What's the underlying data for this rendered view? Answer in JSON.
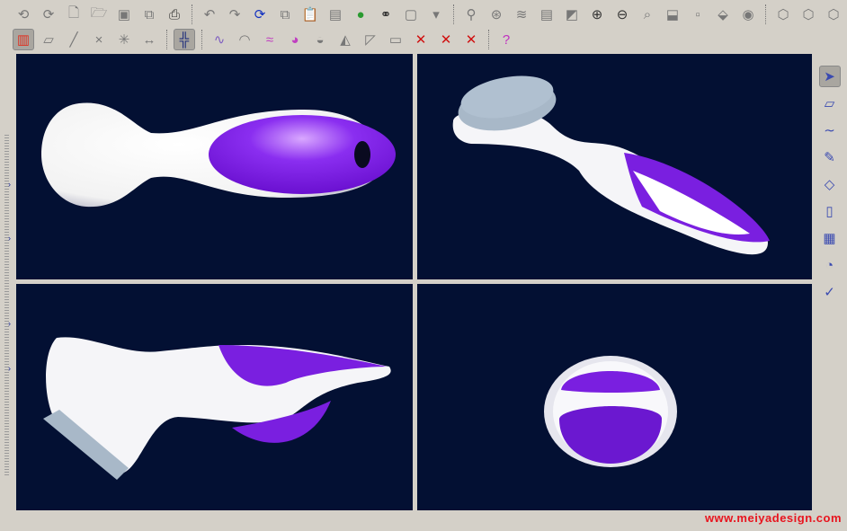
{
  "toolbar_row1": [
    "regenerate-icon",
    "regenerate-manager-icon",
    "new-file-icon",
    "open-folder-icon",
    "save-icon",
    "save-copy-icon",
    "print-icon",
    "|",
    "undo-icon",
    "redo-icon",
    "refresh-icon",
    "copy-icon",
    "paste-icon",
    "paste-special-icon",
    "traffic-light-icon",
    "find-binoculars-icon",
    "select-box-icon",
    "dropdown-icon",
    "|",
    "datum-display-icon",
    "spin-center-icon",
    "layers-icon",
    "model-tree-icon",
    "repaint-icon",
    "zoom-in-icon",
    "zoom-out-icon",
    "refit-icon",
    "orient-icon",
    "saved-views-icon",
    "view-manager-icon",
    "visibility-eye-icon",
    "|",
    "wireframe-icon",
    "hidden-line-icon",
    "no-hidden-icon",
    "shading-icon"
  ],
  "toolbar_row2": [
    "color-spectrum-icon",
    "datum-planes-icon",
    "datum-axes-icon",
    "datum-points-icon",
    "coordinate-systems-icon",
    "measure-icon",
    "|",
    "four-view-layout-icon",
    "|",
    "curvature-icon",
    "section-icon",
    "offset-icon",
    "shaded-curvature-icon",
    "draft-icon",
    "dihedral-icon",
    "reflection-icon",
    "save-analysis-icon",
    "delete-analysis-icon",
    "delete-curve-analysis-icon",
    "delete-surface-analysis-icon",
    "|",
    "context-help-icon"
  ],
  "right_toolbar": [
    "select-arrow-icon",
    "sketch-plane-icon",
    "curve-icon",
    "draw-curve-icon",
    "boundary-surface-icon",
    "surface-icon",
    "surface-from-curves-icon",
    "connect-surfaces-icon",
    "done-checkmark-icon"
  ],
  "glyphs": {
    "|": "",
    "regenerate-icon": "⟲",
    "regenerate-manager-icon": "⟳",
    "new-file-icon": "🗋",
    "open-folder-icon": "🗁",
    "save-icon": "▣",
    "save-copy-icon": "⧉",
    "print-icon": "⎙",
    "undo-icon": "↶",
    "redo-icon": "↷",
    "refresh-icon": "⟳",
    "copy-icon": "⧉",
    "paste-icon": "📋",
    "paste-special-icon": "▤",
    "traffic-light-icon": "●",
    "find-binoculars-icon": "⚭",
    "select-box-icon": "▢",
    "dropdown-icon": "▾",
    "datum-display-icon": "⚲",
    "spin-center-icon": "⊛",
    "layers-icon": "≋",
    "model-tree-icon": "▤",
    "repaint-icon": "◩",
    "zoom-in-icon": "⊕",
    "zoom-out-icon": "⊖",
    "refit-icon": "⌕",
    "orient-icon": "⬓",
    "saved-views-icon": "▫",
    "view-manager-icon": "⬙",
    "visibility-eye-icon": "◉",
    "wireframe-icon": "⬡",
    "hidden-line-icon": "⬡",
    "no-hidden-icon": "⬡",
    "shading-icon": "■",
    "color-spectrum-icon": "▥",
    "datum-planes-icon": "▱",
    "datum-axes-icon": "╱",
    "datum-points-icon": "×",
    "coordinate-systems-icon": "✳",
    "measure-icon": "↔",
    "four-view-layout-icon": "╬",
    "curvature-icon": "∿",
    "section-icon": "◠",
    "offset-icon": "≈",
    "shaded-curvature-icon": "◕",
    "draft-icon": "◒",
    "dihedral-icon": "◭",
    "reflection-icon": "◸",
    "save-analysis-icon": "▭",
    "delete-analysis-icon": "✕",
    "delete-curve-analysis-icon": "✕",
    "delete-surface-analysis-icon": "✕",
    "context-help-icon": "?",
    "select-arrow-icon": "➤",
    "sketch-plane-icon": "▱",
    "curve-icon": "∼",
    "draw-curve-icon": "✎",
    "boundary-surface-icon": "◇",
    "surface-icon": "▯",
    "surface-from-curves-icon": "▦",
    "connect-surfaces-icon": "◔",
    "done-checkmark-icon": "✓"
  },
  "colors": {
    "viewport_bg": "#031033",
    "body_purple": "#7a1fe0",
    "body_white": "#ffffff",
    "cap": "#a8b8c8"
  },
  "watermark": "www.meiyadesign.com"
}
